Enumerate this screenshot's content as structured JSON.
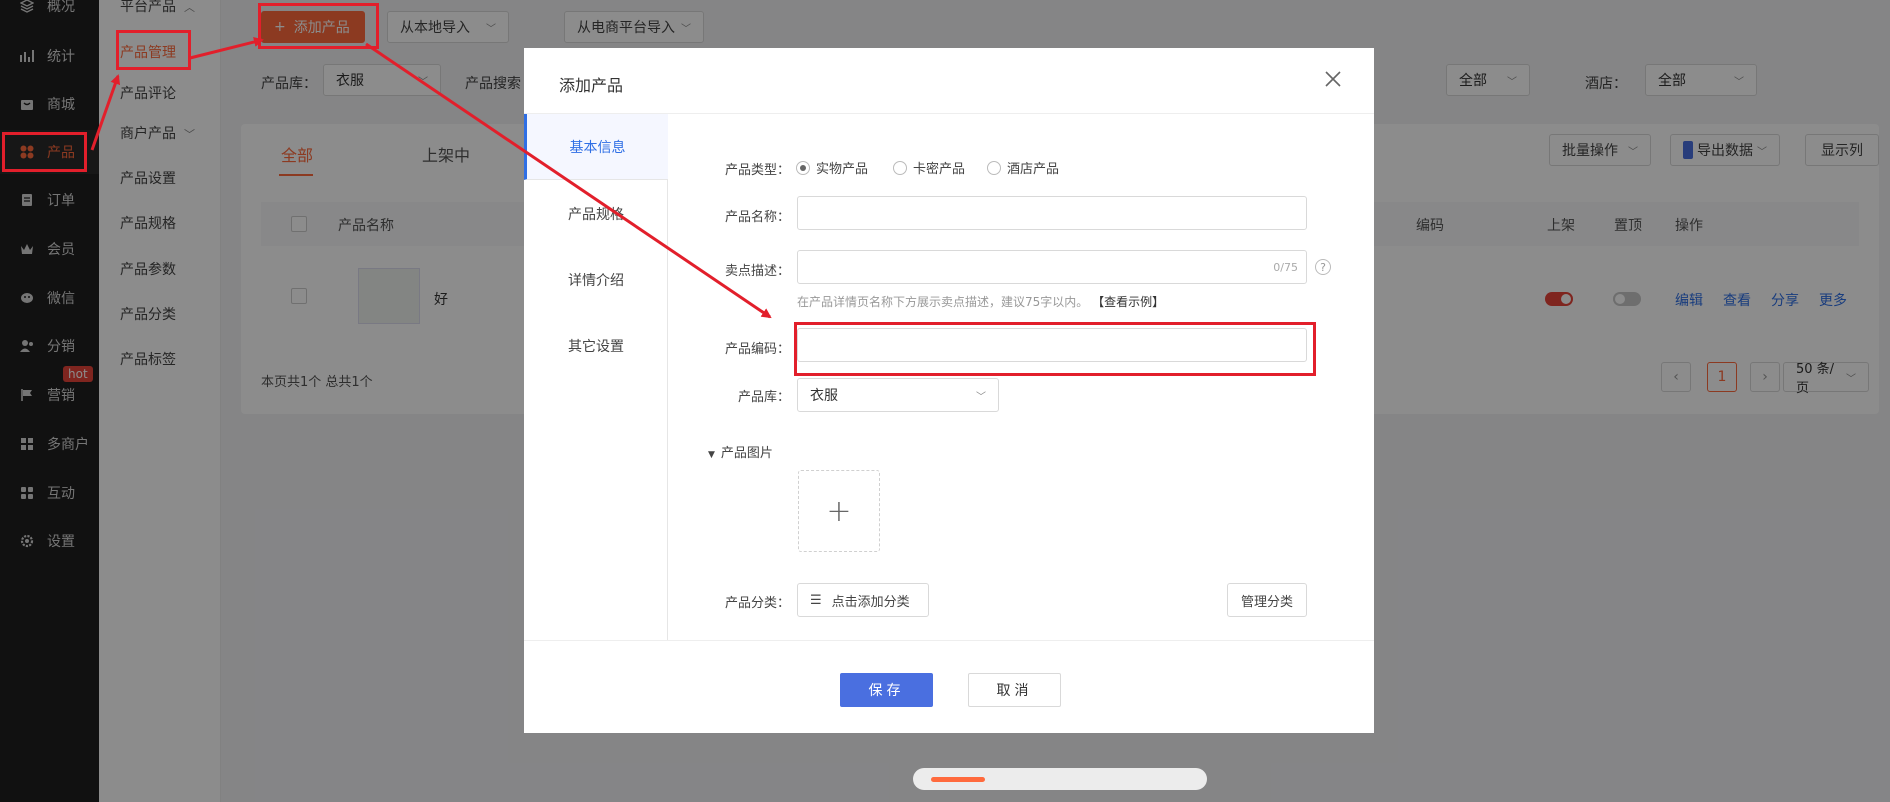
{
  "sidebar": {
    "items": [
      {
        "label": "概况",
        "icon": "layers-icon"
      },
      {
        "label": "统计",
        "icon": "chart-icon"
      },
      {
        "label": "商城",
        "icon": "shop-icon"
      },
      {
        "label": "产品",
        "icon": "grid-icon"
      },
      {
        "label": "订单",
        "icon": "order-icon"
      },
      {
        "label": "会员",
        "icon": "crown-icon"
      },
      {
        "label": "微信",
        "icon": "wechat-icon"
      },
      {
        "label": "分销",
        "icon": "users-icon"
      },
      {
        "label": "营销",
        "icon": "flag-icon"
      },
      {
        "label": "多商户",
        "icon": "store-icon"
      },
      {
        "label": "互动",
        "icon": "blocks-icon"
      },
      {
        "label": "设置",
        "icon": "gear-icon"
      }
    ],
    "hot_badge": "hot"
  },
  "subnav": {
    "items": [
      "平台产品",
      "产品管理",
      "产品评论",
      "商户产品",
      "产品设置",
      "产品规格",
      "产品参数",
      "产品分类",
      "产品标签"
    ]
  },
  "toolbar": {
    "add_product": "添加产品",
    "import_local": "从本地导入",
    "import_ecommerce": "从电商平台导入"
  },
  "filters": {
    "library_label": "产品库：",
    "library_value": "衣服",
    "search_label": "产品搜索",
    "select_all_1": "全部",
    "hotel_label": "酒店：",
    "hotel_value": "全部"
  },
  "list": {
    "tabs": [
      "全部",
      "上架中"
    ],
    "batch": "批量操作",
    "export": "导出数据",
    "columns_btn": "显示列",
    "headers": {
      "name": "产品名称",
      "code": "编码",
      "on_shelf": "上架",
      "top": "置顶",
      "actions": "操作"
    },
    "row": {
      "name": "好",
      "actions": [
        "编辑",
        "查看",
        "分享",
        "更多"
      ]
    },
    "summary": "本页共1个 总共1个",
    "page": "1",
    "page_size": "50 条/页"
  },
  "modal": {
    "title": "添加产品",
    "nav": [
      "基本信息",
      "产品规格",
      "详情介绍",
      "其它设置"
    ],
    "type_label": "产品类型：",
    "types": [
      "实物产品",
      "卡密产品",
      "酒店产品"
    ],
    "name_label": "产品名称：",
    "sell_label": "卖点描述：",
    "sell_count": "0/75",
    "sell_hint": "在产品详情页名称下方展示卖点描述，建议75字以内。",
    "sell_hint_link": "【查看示例】",
    "code_label": "产品编码：",
    "library_label": "产品库：",
    "library_value": "衣服",
    "images_label": "产品图片",
    "category_label": "产品分类：",
    "category_add": "点击添加分类",
    "manage_category": "管理分类",
    "save": "保存",
    "cancel": "取消"
  },
  "colors": {
    "accent": "#ff6a3d",
    "primary": "#4a6fe0",
    "annotation": "#e21f2b"
  }
}
